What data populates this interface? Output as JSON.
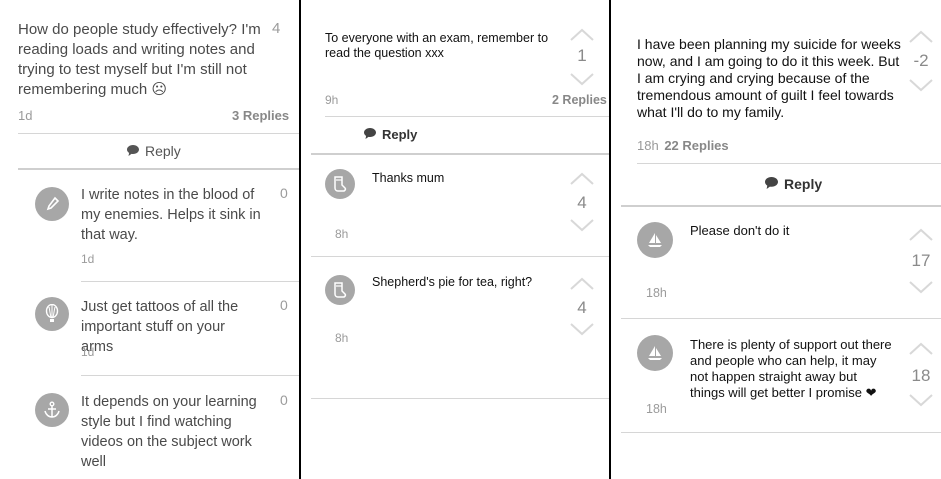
{
  "panel1": {
    "post": {
      "text": "How do people study effectively? I'm reading loads and writing notes and trying to test myself but I'm still not remembering much ☹",
      "score": "4",
      "time": "1d",
      "replies": "3 Replies"
    },
    "reply_label": "Reply",
    "comments": [
      {
        "text": "I write notes in the blood of my enemies. Helps it sink in that way.",
        "score": "0",
        "time": "1d",
        "icon": "pen-icon"
      },
      {
        "text": "Just get tattoos of all the important stuff on your arms",
        "score": "0",
        "time": "1d",
        "icon": "balloon-icon"
      },
      {
        "text": "It depends on your learning style but I find watching videos on the subject work well",
        "score": "0",
        "icon": "anchor-icon"
      }
    ]
  },
  "panel2": {
    "post": {
      "text": "To everyone with an exam, remember to read the question xxx",
      "score": "1",
      "time": "9h",
      "replies": "2 Replies"
    },
    "reply_label": "Reply",
    "comments": [
      {
        "text": "Thanks mum",
        "score": "4",
        "time": "8h",
        "icon": "sock-icon"
      },
      {
        "text": "Shepherd's pie for tea, right?",
        "score": "4",
        "time": "8h",
        "icon": "sock-icon"
      }
    ]
  },
  "panel3": {
    "post": {
      "text": "I have been planning my suicide for weeks now, and I am going to do it this week. But I am crying and crying because of the tremendous amount of guilt I feel towards what I'll do to my family.",
      "score": "-2",
      "time": "18h",
      "replies": "22 Replies"
    },
    "reply_label": "Reply",
    "comments": [
      {
        "text": "Please don't do it",
        "score": "17",
        "time": "18h",
        "icon": "sailboat-icon"
      },
      {
        "text": "There is plenty of support out there and people who can help, it may not happen straight away but things will get better I promise ❤",
        "score": "18",
        "time": "18h",
        "icon": "sailboat-icon"
      }
    ]
  }
}
